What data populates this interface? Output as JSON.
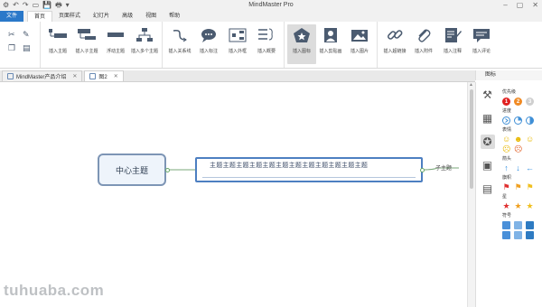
{
  "app_title": "MindMaster Pro",
  "quick_access": [
    "↶",
    "↷",
    "▭",
    "💾",
    "🖶",
    "▾"
  ],
  "menu_tabs": [
    {
      "label": "文件"
    },
    {
      "label": "首页"
    },
    {
      "label": "页面样式"
    },
    {
      "label": "幻灯片"
    },
    {
      "label": "高级"
    },
    {
      "label": "视图"
    },
    {
      "label": "帮助"
    }
  ],
  "ribbon": {
    "buttons": [
      {
        "label": "插入主题"
      },
      {
        "label": "插入子主题"
      },
      {
        "label": "浮动主题"
      },
      {
        "label": "插入多个主题"
      },
      {
        "label": "插入关系线"
      },
      {
        "label": "插入标注"
      },
      {
        "label": "插入外框"
      },
      {
        "label": "插入概要"
      },
      {
        "label": "插入图标"
      },
      {
        "label": "插入剪贴画"
      },
      {
        "label": "插入图片"
      },
      {
        "label": "插入超链接"
      },
      {
        "label": "插入附件"
      },
      {
        "label": "插入注释"
      },
      {
        "label": "插入评论"
      }
    ]
  },
  "doc_tabs": [
    {
      "label": "MindMaster产品介绍",
      "close": "✕"
    },
    {
      "label": "图2",
      "close": "✕"
    }
  ],
  "side_panel_title": "图标",
  "mindmap": {
    "central_topic": "中心主题",
    "main_topic": "主题主题主题主题主题主题主题主题主题主题主题主题",
    "sub_topic": "子主题"
  },
  "icon_library": {
    "categories": [
      {
        "label": "优先级"
      },
      {
        "label": "进度"
      },
      {
        "label": "表情"
      },
      {
        "label": "箭头"
      },
      {
        "label": "旗帜"
      },
      {
        "label": "星"
      },
      {
        "label": "符号"
      }
    ],
    "priority_icons": [
      "1",
      "2",
      "3"
    ],
    "colors": {
      "priority": [
        "#e02020",
        "#f08a24",
        "#cfcfcf"
      ],
      "progress": "#3f8fd6",
      "arrow": "#2f8de0",
      "flags": [
        "#e03030",
        "#f0a020",
        "#f0c020"
      ],
      "stars": [
        "#e03030",
        "#f0a020",
        "#f0c020"
      ],
      "symbols": [
        "#4a90d9",
        "#7fb3e6",
        "#2e7bc2"
      ]
    }
  },
  "watermark": "tuhuaba.com"
}
